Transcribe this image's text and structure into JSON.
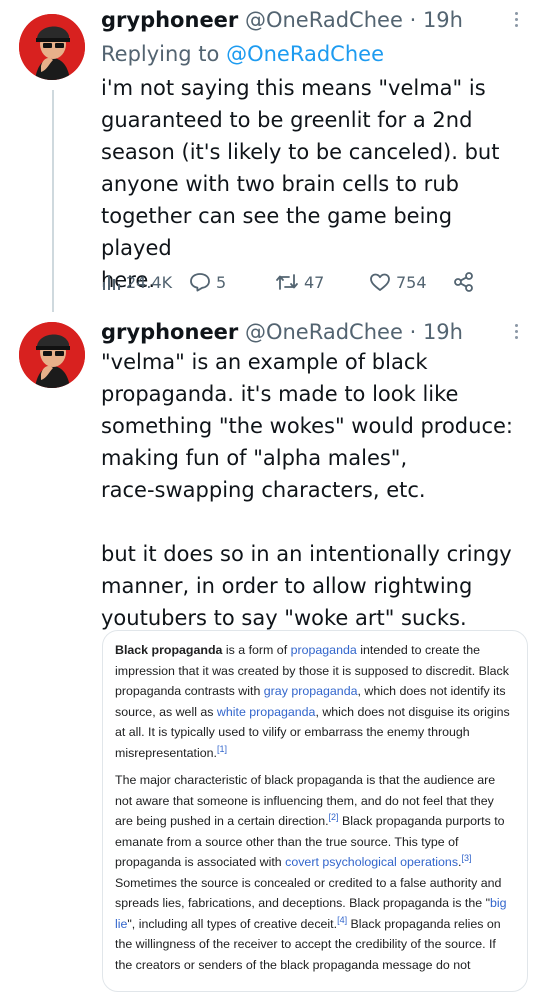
{
  "tweets": [
    {
      "name": "gryphoneer",
      "handle": "@OneRadChee",
      "separator": "·",
      "time": "19h",
      "replying_label": "Replying to",
      "replying_to": "@OneRadChee",
      "text": "i'm not saying this means \"velma\" is\nguaranteed to be greenlit for a 2nd\nseason (it's likely to be canceled). but\nanyone with two brain cells to rub\ntogether can see the game being played\nhere.",
      "stats": {
        "views": "24.4K",
        "replies": "5",
        "retweets": "47",
        "likes": "754"
      }
    },
    {
      "name": "gryphoneer",
      "handle": "@OneRadChee",
      "separator": "·",
      "time": "19h",
      "text": "\"velma\" is an example of black\npropaganda. it's made to look like\nsomething \"the wokes\" would produce:\nmaking fun of \"alpha males\",\nrace-swapping characters, etc.\n\nbut it does so in an intentionally cringy\nmanner, in order to allow rightwing\nyoutubers to say \"woke art\" sucks."
    }
  ],
  "wiki": {
    "p1": [
      {
        "t": "Black propaganda",
        "s": "b"
      },
      {
        "t": " is a form of "
      },
      {
        "t": "propaganda",
        "s": "lnk"
      },
      {
        "t": " intended to create the impression that it was created by those it is supposed to discredit. Black propaganda contrasts with "
      },
      {
        "t": "gray propaganda",
        "s": "lnk"
      },
      {
        "t": ", which does not identify its source, as well as "
      },
      {
        "t": "white propaganda",
        "s": "lnk"
      },
      {
        "t": ", which does not disguise its origins at all. It is typically used to vilify or embarrass the enemy through misrepresentation."
      },
      {
        "t": "[1]",
        "s": "sup"
      }
    ],
    "p2": [
      {
        "t": "The major characteristic of black propaganda is that the audience are not aware that someone is influencing them, and do not feel that they are being pushed in a certain direction."
      },
      {
        "t": "[2]",
        "s": "sup"
      },
      {
        "t": " Black propaganda purports to emanate from a source other than the true source. This type of propaganda is associated with "
      },
      {
        "t": "covert psychological operations",
        "s": "lnk"
      },
      {
        "t": ".",
        "s": ""
      },
      {
        "t": "[3]",
        "s": "sup"
      },
      {
        "t": " Sometimes the source is concealed or credited to a false authority and spreads lies, fabrications, and deceptions. Black propaganda is the \""
      },
      {
        "t": "big lie",
        "s": "lnk"
      },
      {
        "t": "\", including all types of creative deceit."
      },
      {
        "t": "[4]",
        "s": "sup"
      },
      {
        "t": " Black propaganda relies on the willingness of the receiver to accept the credibility of the source. If the creators or senders of the black propaganda message do not"
      }
    ]
  },
  "colors": {
    "link": "#1d9bf0",
    "muted": "#536471",
    "avatar_bg": "#d8211f",
    "wiki_link": "#3366cc"
  },
  "icons": [
    "views-icon",
    "reply-icon",
    "retweet-icon",
    "like-icon",
    "share-icon",
    "more-icon"
  ]
}
